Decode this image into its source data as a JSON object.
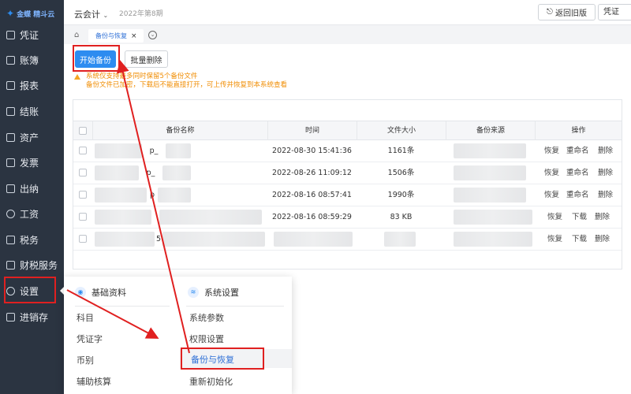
{
  "sidebar": {
    "logo_text": "金蝶 精斗云",
    "items": [
      {
        "label": "凭证",
        "icon": "voucher-icon"
      },
      {
        "label": "账簿",
        "icon": "ledger-icon"
      },
      {
        "label": "报表",
        "icon": "report-icon"
      },
      {
        "label": "结账",
        "icon": "closing-icon"
      },
      {
        "label": "资产",
        "icon": "asset-icon"
      },
      {
        "label": "发票",
        "icon": "invoice-icon"
      },
      {
        "label": "出纳",
        "icon": "cashier-icon"
      },
      {
        "label": "工资",
        "icon": "salary-icon"
      },
      {
        "label": "税务",
        "icon": "tax-icon"
      },
      {
        "label": "财税服务",
        "icon": "service-icon"
      },
      {
        "label": "设置",
        "icon": "settings-icon"
      },
      {
        "label": "进销存",
        "icon": "inventory-icon"
      }
    ]
  },
  "topbar": {
    "app_name": "云会计",
    "period": "2022年第8期",
    "back_button": "返回旧版",
    "search_value": "凭证"
  },
  "tabs": [
    {
      "label": "备份与恢复"
    }
  ],
  "toolbar": {
    "start_backup": "开始备份",
    "batch_delete": "批量删除"
  },
  "warning": {
    "line1": "系统仅支持最多同时保留5个备份文件",
    "line2": "备份文件已加密，下载后不能直接打开，可上传并恢复到本系统查看"
  },
  "table": {
    "headers": [
      "备份名称",
      "时间",
      "文件大小",
      "备份来源",
      "操作"
    ],
    "rows": [
      {
        "name": "p_",
        "time": "2022-08-30 15:41:36",
        "size": "1161条",
        "ops": [
          "恢复",
          "重命名",
          "删除"
        ]
      },
      {
        "name": "p_",
        "time": "2022-08-26 11:09:12",
        "size": "1506条",
        "ops": [
          "恢复",
          "重命名",
          "删除"
        ]
      },
      {
        "name": "p",
        "time": "2022-08-16 08:57:41",
        "size": "1990条",
        "ops": [
          "恢复",
          "重命名",
          "删除"
        ]
      },
      {
        "name": "",
        "time": "2022-08-16 08:59:29",
        "size": "83 KB",
        "ops": [
          "恢复",
          "下载",
          "删除"
        ]
      },
      {
        "name": "5",
        "time": "",
        "size": "",
        "ops": [
          "恢复",
          "下载",
          "删除"
        ]
      }
    ]
  },
  "popup": {
    "col1_title": "基础资料",
    "col1_items": [
      "科目",
      "凭证字",
      "币别",
      "辅助核算"
    ],
    "col2_title": "系统设置",
    "col2_items": [
      "系统参数",
      "权限设置",
      "备份与恢复",
      "重新初始化"
    ]
  },
  "colors": {
    "sidebar_bg": "#2b3441",
    "primary": "#2d8cf0",
    "annotation_red": "#e02020",
    "warning": "#f08c00"
  }
}
